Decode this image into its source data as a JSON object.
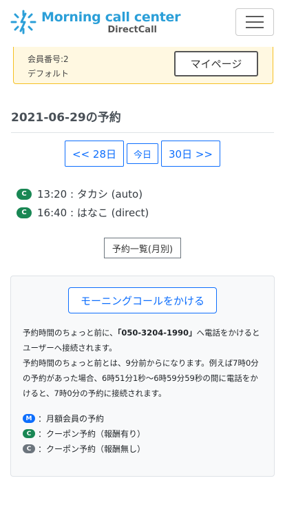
{
  "brand": {
    "title": "Morning call center",
    "subtitle": "DirectCall",
    "accent": "#2b9fd8"
  },
  "nav": {
    "menu_icon": "hamburger-icon"
  },
  "member": {
    "number": "会員番号:2",
    "plan": "デフォルト",
    "mypage_label": "マイページ"
  },
  "page": {
    "title": "2021-06-29の予約"
  },
  "date_nav": {
    "prev_label": "<< 28日",
    "today_label": "今日",
    "next_label": "30日 >>"
  },
  "reservations": [
    {
      "badge": "C",
      "text": "13:20 : タカシ (auto)"
    },
    {
      "badge": "C",
      "text": "16:40 : はなこ (direct)"
    }
  ],
  "list_button": "予約一覧(月別)",
  "card": {
    "call_button": "モーニングコールをかける",
    "desc_pre": "予約時間のちょっと前に、",
    "desc_phone": "「050-3204-1990」",
    "desc_post": "へ電話をかけるとユーザーへ接続されます。",
    "desc_2": "予約時間のちょっと前とは、9分前からになります。例えば7時0分の予約があった場合、6時51分1秒〜6時59分59秒の間に電話をかけると、7時0分の予約に接続されます。",
    "legend": [
      {
        "badge": "M",
        "text": "：月額会員の予約",
        "color": "#0d6efd"
      },
      {
        "badge": "C",
        "text": "：クーポン予約（報酬有り）",
        "color": "#198754"
      },
      {
        "badge": "C",
        "text": "：クーポン予約（報酬無し）",
        "color": "#6c757d"
      }
    ]
  }
}
